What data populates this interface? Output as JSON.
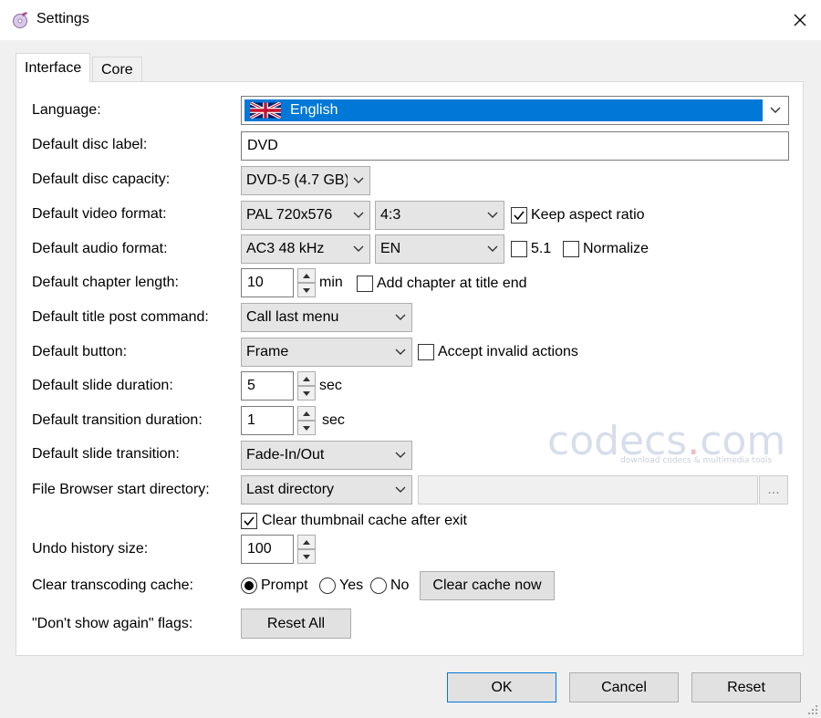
{
  "window": {
    "title": "Settings"
  },
  "tabs": [
    {
      "label": "Interface"
    },
    {
      "label": "Core"
    }
  ],
  "settings": {
    "language": {
      "label": "Language:",
      "value": "English"
    },
    "disc_label": {
      "label": "Default disc label:",
      "value": "DVD"
    },
    "disc_capacity": {
      "label": "Default disc capacity:",
      "value": "DVD-5 (4.7 GB)"
    },
    "video_format": {
      "label": "Default video format:",
      "value": "PAL 720x576",
      "aspect": "4:3",
      "keep_aspect_label": "Keep aspect ratio",
      "keep_aspect_checked": true
    },
    "audio_format": {
      "label": "Default audio format:",
      "value": "AC3 48 kHz",
      "lang": "EN",
      "surround_label": "5.1",
      "surround_checked": false,
      "normalize_label": "Normalize",
      "normalize_checked": false
    },
    "chapter_length": {
      "label": "Default chapter length:",
      "value": "10",
      "unit": "min",
      "add_chapter_label": "Add chapter at title end",
      "add_chapter_checked": false
    },
    "post_command": {
      "label": "Default title post command:",
      "value": "Call last menu"
    },
    "button": {
      "label": "Default button:",
      "value": "Frame",
      "accept_invalid_label": "Accept invalid actions",
      "accept_invalid_checked": false
    },
    "slide_duration": {
      "label": "Default slide duration:",
      "value": "5",
      "unit": "sec"
    },
    "transition_duration": {
      "label": "Default transition duration:",
      "value": "1",
      "unit": "sec"
    },
    "slide_transition": {
      "label": "Default slide transition:",
      "value": "Fade-In/Out"
    },
    "browser_start": {
      "label": "File Browser start directory:",
      "value": "Last directory",
      "path": "",
      "browse_label": "..."
    },
    "clear_thumb": {
      "label": "Clear thumbnail cache after exit",
      "checked": true
    },
    "undo_history": {
      "label": "Undo history size:",
      "value": "100"
    },
    "transcoding": {
      "label": "Clear transcoding cache:",
      "options": [
        "Prompt",
        "Yes",
        "No"
      ],
      "selected": "Prompt",
      "clear_now_label": "Clear cache now"
    },
    "dont_show": {
      "label": "\"Don't show again\" flags:",
      "reset_all_label": "Reset All"
    }
  },
  "watermark": {
    "main": "codecs",
    "dot": ".",
    "tld": "com",
    "sub": "download codecs & multimedia tools"
  },
  "footer": {
    "ok_label": "OK",
    "cancel_label": "Cancel",
    "reset_label": "Reset"
  }
}
